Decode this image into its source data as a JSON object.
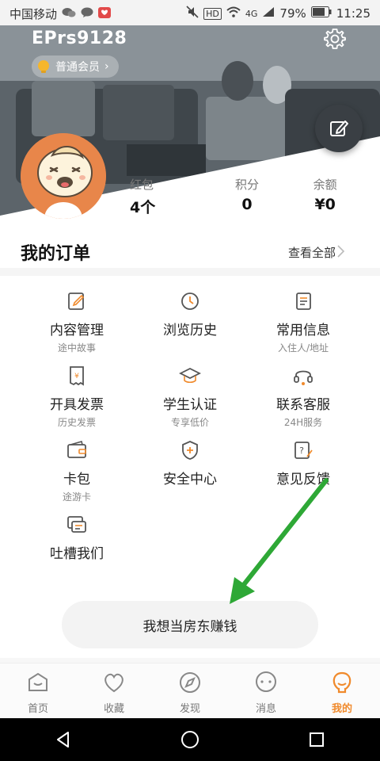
{
  "status_bar": {
    "carrier": "中国移动",
    "right_badges": [
      "HD",
      "4G"
    ],
    "battery": "79%",
    "time": "11:25"
  },
  "header": {
    "username": "EPrs9128",
    "member_level": "普通会员",
    "member_chevron": "›"
  },
  "stats": [
    {
      "label": "红包",
      "value": "4个"
    },
    {
      "label": "积分",
      "value": "0"
    },
    {
      "label": "余额",
      "value": "¥0"
    }
  ],
  "orders": {
    "title": "我的订单",
    "view_all": "查看全部"
  },
  "services": [
    {
      "title": "内容管理",
      "sub": "途中故事",
      "icon": "content-manage-icon"
    },
    {
      "title": "浏览历史",
      "sub": "",
      "icon": "clock-icon"
    },
    {
      "title": "常用信息",
      "sub": "入住人/地址",
      "icon": "info-book-icon"
    },
    {
      "title": "开具发票",
      "sub": "历史发票",
      "icon": "invoice-icon"
    },
    {
      "title": "学生认证",
      "sub": "专享低价",
      "icon": "graduation-cap-icon"
    },
    {
      "title": "联系客服",
      "sub": "24H服务",
      "icon": "headset-icon"
    },
    {
      "title": "卡包",
      "sub": "途游卡",
      "icon": "wallet-icon"
    },
    {
      "title": "安全中心",
      "sub": "",
      "icon": "shield-plus-icon"
    },
    {
      "title": "意见反馈",
      "sub": "",
      "icon": "feedback-icon"
    },
    {
      "title": "吐槽我们",
      "sub": "",
      "icon": "chat-complaint-icon"
    }
  ],
  "landlord_button": "我想当房东赚钱",
  "bottom_nav": [
    {
      "label": "首页",
      "icon": "home-icon",
      "active": false
    },
    {
      "label": "收藏",
      "icon": "heart-icon",
      "active": false
    },
    {
      "label": "发现",
      "icon": "compass-icon",
      "active": false
    },
    {
      "label": "消息",
      "icon": "message-icon",
      "active": false
    },
    {
      "label": "我的",
      "icon": "profile-icon",
      "active": true
    }
  ],
  "colors": {
    "accent": "#f08a2c",
    "annotation_arrow": "#2ea836"
  }
}
